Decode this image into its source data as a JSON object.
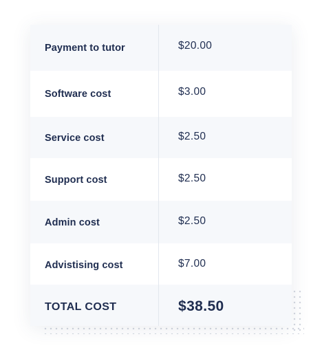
{
  "cost_table": {
    "rows": [
      {
        "label": "Payment to tutor",
        "value": "$20.00"
      },
      {
        "label": "Software cost",
        "value": "$3.00"
      },
      {
        "label": "Service cost",
        "value": "$2.50"
      },
      {
        "label": "Support cost",
        "value": "$2.50"
      },
      {
        "label": "Admin cost",
        "value": "$2.50"
      },
      {
        "label": "Advistising cost",
        "value": "$7.00"
      }
    ],
    "total": {
      "label": "TOTAL COST",
      "value": "$38.50"
    }
  },
  "colors": {
    "text": "#1f2d50",
    "row_shade": "#f6f8fb",
    "divider": "#e3e7ee",
    "background": "#ffffff"
  }
}
